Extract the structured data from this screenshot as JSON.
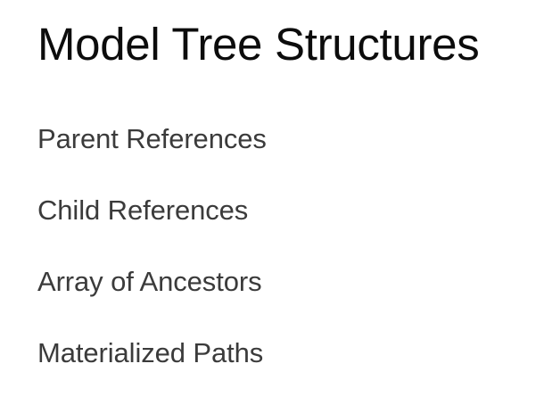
{
  "page": {
    "title": "Model Tree Structures"
  },
  "nav": {
    "items": [
      {
        "label": "Parent References"
      },
      {
        "label": "Child References"
      },
      {
        "label": "Array of Ancestors"
      },
      {
        "label": "Materialized Paths"
      }
    ]
  },
  "colors": {
    "background": "#ffffff",
    "title": "#0c0c0c",
    "link": "#3b3b3b"
  }
}
